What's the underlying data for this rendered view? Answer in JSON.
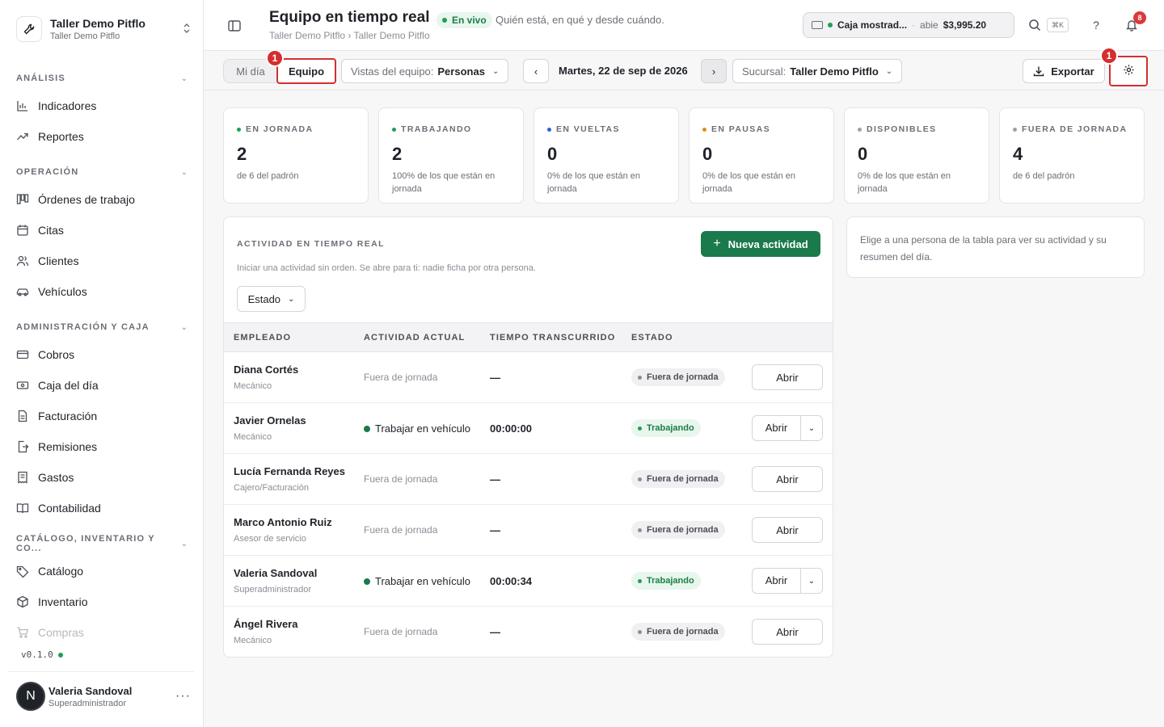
{
  "sidebar": {
    "org_name": "Taller Demo Pitflo",
    "org_sub": "Taller Demo Pitflo",
    "sections": {
      "analisis": "ANÁLISIS",
      "operacion": "OPERACIÓN",
      "admin": "ADMINISTRACIÓN Y CAJA",
      "catalogo": "CATÁLOGO, INVENTARIO Y CO..."
    },
    "items": {
      "indicadores": "Indicadores",
      "reportes": "Reportes",
      "ordenes": "Órdenes de trabajo",
      "citas": "Citas",
      "clientes": "Clientes",
      "vehiculos": "Vehículos",
      "cobros": "Cobros",
      "caja": "Caja del día",
      "facturacion": "Facturación",
      "remisiones": "Remisiones",
      "gastos": "Gastos",
      "contabilidad": "Contabilidad",
      "catalogo": "Catálogo",
      "inventario": "Inventario",
      "compras": "Compras"
    },
    "version": "v0.1.0",
    "user": {
      "initial": "N",
      "name": "Valeria Sandoval",
      "role": "Superadministrador"
    }
  },
  "header": {
    "title": "Equipo en tiempo real",
    "live": "En vivo",
    "subtitle": "Quién está, en qué y desde cuándo.",
    "breadcrumb": "Taller Demo Pitflo › Taller Demo Pitflo",
    "cash": {
      "name": "Caja mostrad...",
      "sep": "·",
      "state": "abie",
      "amount": "$3,995.20"
    },
    "shortcut": "⌘K",
    "notifications": "8"
  },
  "toolbar": {
    "tab_mi_dia": "Mi día",
    "tab_equipo": "Equipo",
    "marker": "1",
    "view_label": "Vistas del equipo:",
    "view_value": "Personas",
    "prev": "‹",
    "next": "›",
    "date": "Martes, 22 de sep de 2026",
    "branch_label": "Sucursal:",
    "branch_value": "Taller Demo Pitflo",
    "export": "Exportar"
  },
  "kpis": [
    {
      "label": "EN JORNADA",
      "value": "2",
      "note": "de 6 del padrón",
      "color": "#1e9e55"
    },
    {
      "label": "TRABAJANDO",
      "value": "2",
      "note": "100% de los que están en jornada",
      "color": "#1e9e55"
    },
    {
      "label": "EN VUELTAS",
      "value": "0",
      "note": "0% de los que están en jornada",
      "color": "#2f5fd0"
    },
    {
      "label": "EN PAUSAS",
      "value": "0",
      "note": "0% de los que están en jornada",
      "color": "#e08a1e"
    },
    {
      "label": "DISPONIBLES",
      "value": "0",
      "note": "0% de los que están en jornada",
      "color": "#9ca0a6"
    },
    {
      "label": "FUERA DE JORNADA",
      "value": "4",
      "note": "de 6 del padrón",
      "color": "#9ca0a6"
    }
  ],
  "activity": {
    "title": "ACTIVIDAD EN TIEMPO REAL",
    "description": "Iniciar una actividad sin orden. Se abre para ti: nadie ficha por otra persona.",
    "new_button": "Nueva actividad",
    "filter": "Estado",
    "columns": [
      "EMPLEADO",
      "ACTIVIDAD ACTUAL",
      "TIEMPO TRANSCURRIDO",
      "ESTADO"
    ],
    "open_label": "Abrir",
    "rows": [
      {
        "name": "Diana Cortés",
        "role": "Mecánico",
        "activity": "Fuera de jornada",
        "elapsed": "—",
        "status": "Fuera de jornada"
      },
      {
        "name": "Javier Ornelas",
        "role": "Mecánico",
        "activity": "Trabajar en vehículo",
        "elapsed": "00:00:00",
        "status": "Trabajando"
      },
      {
        "name": "Lucía Fernanda Reyes",
        "role": "Cajero/Facturación",
        "activity": "Fuera de jornada",
        "elapsed": "—",
        "status": "Fuera de jornada"
      },
      {
        "name": "Marco Antonio Ruiz",
        "role": "Asesor de servicio",
        "activity": "Fuera de jornada",
        "elapsed": "—",
        "status": "Fuera de jornada"
      },
      {
        "name": "Valeria Sandoval",
        "role": "Superadministrador",
        "activity": "Trabajar en vehículo",
        "elapsed": "00:00:34",
        "status": "Trabajando"
      },
      {
        "name": "Ángel Rivera",
        "role": "Mecánico",
        "activity": "Fuera de jornada",
        "elapsed": "—",
        "status": "Fuera de jornada"
      }
    ]
  },
  "detail": {
    "empty": "Elige a una persona de la tabla para ver su actividad y su resumen del día."
  }
}
